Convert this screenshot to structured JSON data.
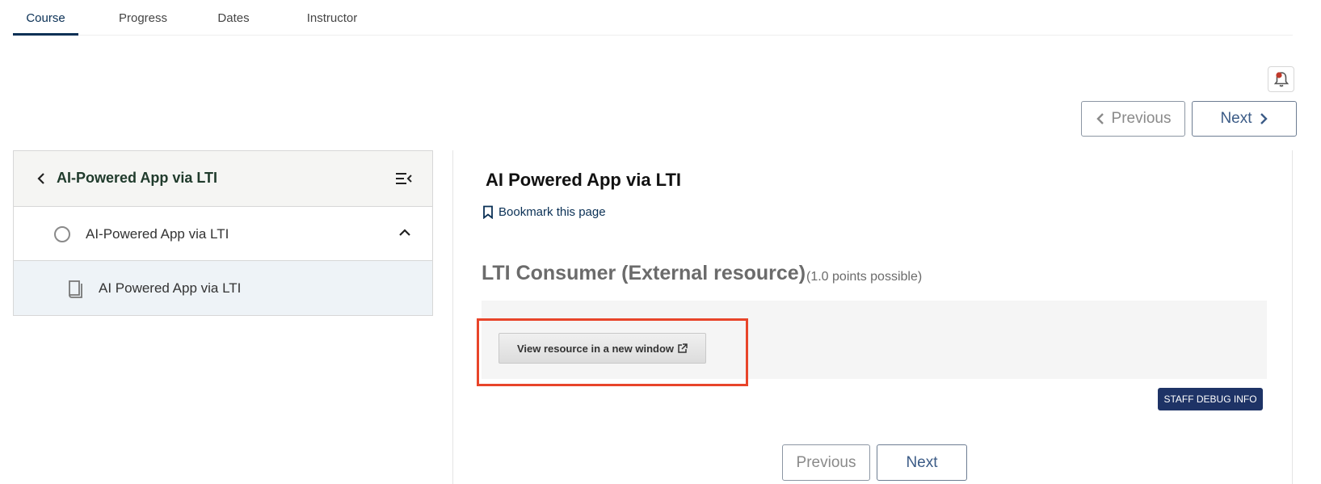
{
  "tabs": [
    {
      "label": "Course",
      "active": true
    },
    {
      "label": "Progress",
      "active": false
    },
    {
      "label": "Dates",
      "active": false
    },
    {
      "label": "Instructor",
      "active": false
    }
  ],
  "icons": {
    "bell": "bell-icon",
    "prev": "chevron-left-icon",
    "next": "chevron-right-icon",
    "back": "chevron-left-icon",
    "menu": "sidebar-collapse-icon",
    "sequence_status": "circle-outline-icon",
    "collapse": "chevron-up-icon",
    "unit": "book-icon",
    "bookmark": "bookmark-outline-icon",
    "external": "external-link-icon"
  },
  "top_nav": {
    "previous_label": "Previous",
    "next_label": "Next"
  },
  "sidebar": {
    "title": "AI-Powered App via LTI",
    "sequence_label": "AI-Powered App via LTI",
    "unit_label": "AI Powered App via LTI"
  },
  "content": {
    "unit_title": "AI Powered App via LTI",
    "bookmark_label": "Bookmark this page",
    "problem_title": "LTI Consumer (External resource)",
    "points": "(1.0 points possible)",
    "view_resource_label": "View resource in a new window",
    "debug_label": "STAFF DEBUG INFO"
  },
  "bottom_nav": {
    "previous_label": "Previous",
    "next_label": "Next"
  },
  "colors": {
    "accent": "#0a3055",
    "highlight": "#e8452a",
    "debug_bg": "#1e3366"
  }
}
